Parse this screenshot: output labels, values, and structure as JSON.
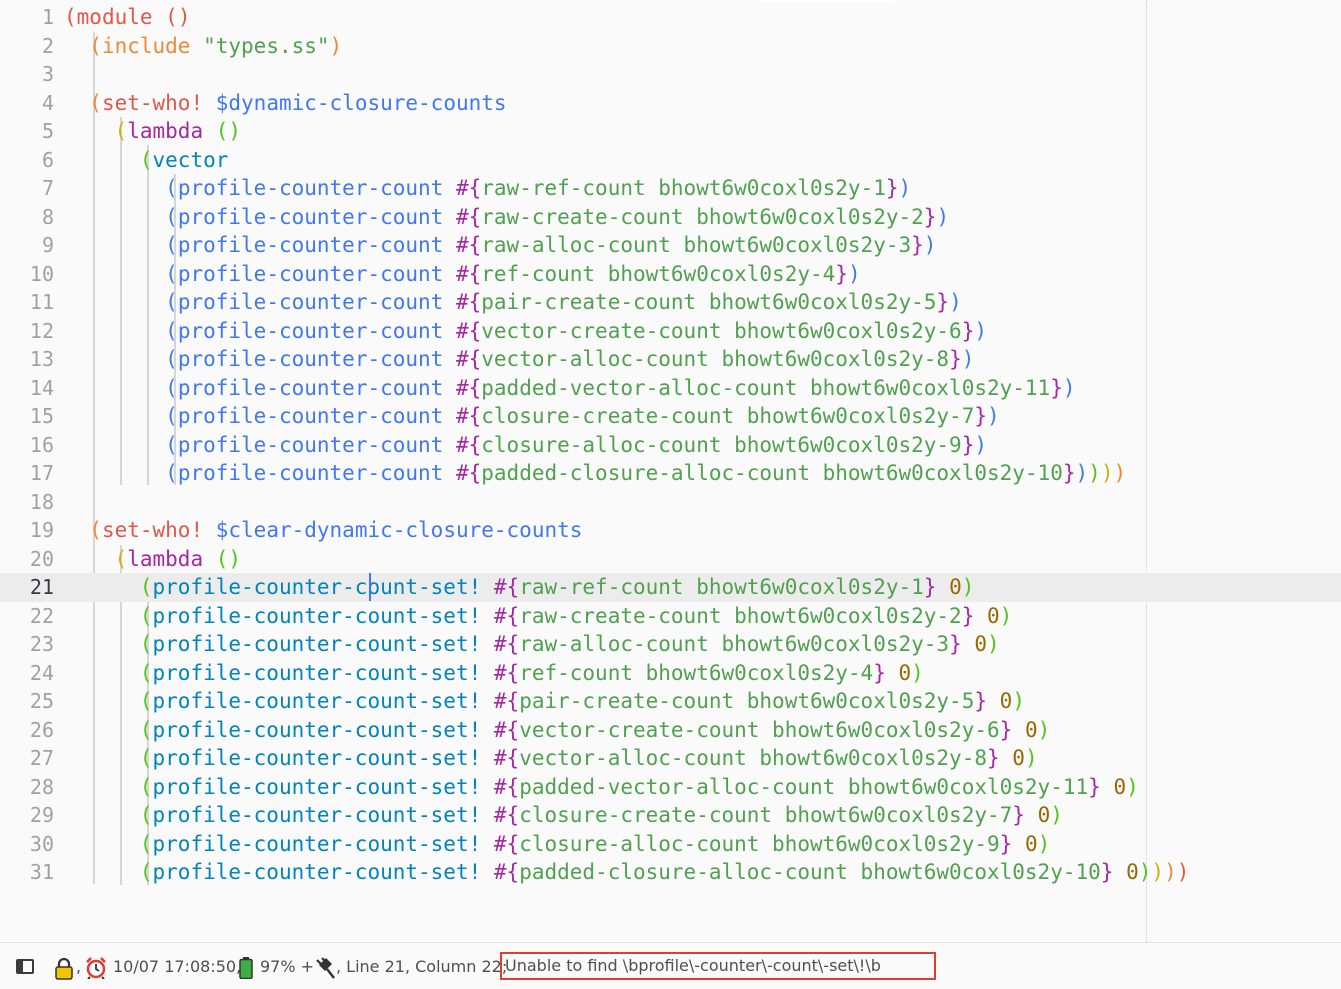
{
  "editor": {
    "current_line": 21,
    "lines": [
      [
        [
          "(",
          "#e45649"
        ],
        [
          "module ",
          "#e45649"
        ],
        [
          "()",
          "#e45649"
        ]
      ],
      [
        [
          "  "
        ],
        [
          "(",
          "#ed8936"
        ],
        [
          "include ",
          "#ed8936"
        ],
        [
          "\"types.ss\"",
          "#50a14f"
        ],
        [
          ")",
          "#ed8936"
        ]
      ],
      [],
      [
        [
          "  "
        ],
        [
          "(",
          "#ed8936"
        ],
        [
          "set-who! ",
          "#e45649"
        ],
        [
          "$dynamic-closure-counts",
          "#4078f2"
        ]
      ],
      [
        [
          "    "
        ],
        [
          "(",
          "#d4b106"
        ],
        [
          "lambda ",
          "#a626a4"
        ],
        [
          "()",
          "#52c41a"
        ]
      ],
      [
        [
          "      "
        ],
        [
          "(",
          "#52c41a"
        ],
        [
          "vector",
          "#0184bc"
        ]
      ],
      [
        [
          "        "
        ],
        [
          "(",
          "#4078f2"
        ],
        [
          "profile-counter-count ",
          "#4078f2"
        ],
        [
          "#{",
          "#a626a4"
        ],
        [
          "raw-ref-count bhowt6w0coxl0s2y-1",
          "#50a14f"
        ],
        [
          "}",
          "#a626a4"
        ],
        [
          ")",
          "#4078f2"
        ]
      ],
      [
        [
          "        "
        ],
        [
          "(",
          "#4078f2"
        ],
        [
          "profile-counter-count ",
          "#4078f2"
        ],
        [
          "#{",
          "#a626a4"
        ],
        [
          "raw-create-count bhowt6w0coxl0s2y-2",
          "#50a14f"
        ],
        [
          "}",
          "#a626a4"
        ],
        [
          ")",
          "#4078f2"
        ]
      ],
      [
        [
          "        "
        ],
        [
          "(",
          "#4078f2"
        ],
        [
          "profile-counter-count ",
          "#4078f2"
        ],
        [
          "#{",
          "#a626a4"
        ],
        [
          "raw-alloc-count bhowt6w0coxl0s2y-3",
          "#50a14f"
        ],
        [
          "}",
          "#a626a4"
        ],
        [
          ")",
          "#4078f2"
        ]
      ],
      [
        [
          "        "
        ],
        [
          "(",
          "#4078f2"
        ],
        [
          "profile-counter-count ",
          "#4078f2"
        ],
        [
          "#{",
          "#a626a4"
        ],
        [
          "ref-count bhowt6w0coxl0s2y-4",
          "#50a14f"
        ],
        [
          "}",
          "#a626a4"
        ],
        [
          ")",
          "#4078f2"
        ]
      ],
      [
        [
          "        "
        ],
        [
          "(",
          "#4078f2"
        ],
        [
          "profile-counter-count ",
          "#4078f2"
        ],
        [
          "#{",
          "#a626a4"
        ],
        [
          "pair-create-count bhowt6w0coxl0s2y-5",
          "#50a14f"
        ],
        [
          "}",
          "#a626a4"
        ],
        [
          ")",
          "#4078f2"
        ]
      ],
      [
        [
          "        "
        ],
        [
          "(",
          "#4078f2"
        ],
        [
          "profile-counter-count ",
          "#4078f2"
        ],
        [
          "#{",
          "#a626a4"
        ],
        [
          "vector-create-count bhowt6w0coxl0s2y-6",
          "#50a14f"
        ],
        [
          "}",
          "#a626a4"
        ],
        [
          ")",
          "#4078f2"
        ]
      ],
      [
        [
          "        "
        ],
        [
          "(",
          "#4078f2"
        ],
        [
          "profile-counter-count ",
          "#4078f2"
        ],
        [
          "#{",
          "#a626a4"
        ],
        [
          "vector-alloc-count bhowt6w0coxl0s2y-8",
          "#50a14f"
        ],
        [
          "}",
          "#a626a4"
        ],
        [
          ")",
          "#4078f2"
        ]
      ],
      [
        [
          "        "
        ],
        [
          "(",
          "#4078f2"
        ],
        [
          "profile-counter-count ",
          "#4078f2"
        ],
        [
          "#{",
          "#a626a4"
        ],
        [
          "padded-vector-alloc-count bhowt6w0coxl0s2y-11",
          "#50a14f"
        ],
        [
          "}",
          "#a626a4"
        ],
        [
          ")",
          "#4078f2"
        ]
      ],
      [
        [
          "        "
        ],
        [
          "(",
          "#4078f2"
        ],
        [
          "profile-counter-count ",
          "#4078f2"
        ],
        [
          "#{",
          "#a626a4"
        ],
        [
          "closure-create-count bhowt6w0coxl0s2y-7",
          "#50a14f"
        ],
        [
          "}",
          "#a626a4"
        ],
        [
          ")",
          "#4078f2"
        ]
      ],
      [
        [
          "        "
        ],
        [
          "(",
          "#4078f2"
        ],
        [
          "profile-counter-count ",
          "#4078f2"
        ],
        [
          "#{",
          "#a626a4"
        ],
        [
          "closure-alloc-count bhowt6w0coxl0s2y-9",
          "#50a14f"
        ],
        [
          "}",
          "#a626a4"
        ],
        [
          ")",
          "#4078f2"
        ]
      ],
      [
        [
          "        "
        ],
        [
          "(",
          "#4078f2"
        ],
        [
          "profile-counter-count ",
          "#4078f2"
        ],
        [
          "#{",
          "#a626a4"
        ],
        [
          "padded-closure-alloc-count bhowt6w0coxl0s2y-10",
          "#50a14f"
        ],
        [
          "}",
          "#a626a4"
        ],
        [
          ")",
          "#4078f2"
        ],
        [
          ")",
          "#52c41a"
        ],
        [
          ")",
          "#d4b106"
        ],
        [
          ")",
          "#ed8936"
        ]
      ],
      [],
      [
        [
          "  "
        ],
        [
          "(",
          "#ed8936"
        ],
        [
          "set-who! ",
          "#e45649"
        ],
        [
          "$clear-dynamic-closure-counts",
          "#4078f2"
        ]
      ],
      [
        [
          "    "
        ],
        [
          "(",
          "#d4b106"
        ],
        [
          "lambda ",
          "#a626a4"
        ],
        [
          "()",
          "#52c41a"
        ]
      ],
      [
        [
          "      "
        ],
        [
          "(",
          "#52c41a"
        ],
        [
          "profile-counter-count-set! ",
          "#0184bc"
        ],
        [
          "#{",
          "#a626a4"
        ],
        [
          "raw-ref-count bhowt6w0coxl0s2y-1",
          "#50a14f"
        ],
        [
          "}",
          "#a626a4"
        ],
        [
          " "
        ],
        [
          "0",
          "#986801"
        ],
        [
          ")",
          "#52c41a"
        ]
      ],
      [
        [
          "      "
        ],
        [
          "(",
          "#52c41a"
        ],
        [
          "profile-counter-count-set! ",
          "#0184bc"
        ],
        [
          "#{",
          "#a626a4"
        ],
        [
          "raw-create-count bhowt6w0coxl0s2y-2",
          "#50a14f"
        ],
        [
          "}",
          "#a626a4"
        ],
        [
          " "
        ],
        [
          "0",
          "#986801"
        ],
        [
          ")",
          "#52c41a"
        ]
      ],
      [
        [
          "      "
        ],
        [
          "(",
          "#52c41a"
        ],
        [
          "profile-counter-count-set! ",
          "#0184bc"
        ],
        [
          "#{",
          "#a626a4"
        ],
        [
          "raw-alloc-count bhowt6w0coxl0s2y-3",
          "#50a14f"
        ],
        [
          "}",
          "#a626a4"
        ],
        [
          " "
        ],
        [
          "0",
          "#986801"
        ],
        [
          ")",
          "#52c41a"
        ]
      ],
      [
        [
          "      "
        ],
        [
          "(",
          "#52c41a"
        ],
        [
          "profile-counter-count-set! ",
          "#0184bc"
        ],
        [
          "#{",
          "#a626a4"
        ],
        [
          "ref-count bhowt6w0coxl0s2y-4",
          "#50a14f"
        ],
        [
          "}",
          "#a626a4"
        ],
        [
          " "
        ],
        [
          "0",
          "#986801"
        ],
        [
          ")",
          "#52c41a"
        ]
      ],
      [
        [
          "      "
        ],
        [
          "(",
          "#52c41a"
        ],
        [
          "profile-counter-count-set! ",
          "#0184bc"
        ],
        [
          "#{",
          "#a626a4"
        ],
        [
          "pair-create-count bhowt6w0coxl0s2y-5",
          "#50a14f"
        ],
        [
          "}",
          "#a626a4"
        ],
        [
          " "
        ],
        [
          "0",
          "#986801"
        ],
        [
          ")",
          "#52c41a"
        ]
      ],
      [
        [
          "      "
        ],
        [
          "(",
          "#52c41a"
        ],
        [
          "profile-counter-count-set! ",
          "#0184bc"
        ],
        [
          "#{",
          "#a626a4"
        ],
        [
          "vector-create-count bhowt6w0coxl0s2y-6",
          "#50a14f"
        ],
        [
          "}",
          "#a626a4"
        ],
        [
          " "
        ],
        [
          "0",
          "#986801"
        ],
        [
          ")",
          "#52c41a"
        ]
      ],
      [
        [
          "      "
        ],
        [
          "(",
          "#52c41a"
        ],
        [
          "profile-counter-count-set! ",
          "#0184bc"
        ],
        [
          "#{",
          "#a626a4"
        ],
        [
          "vector-alloc-count bhowt6w0coxl0s2y-8",
          "#50a14f"
        ],
        [
          "}",
          "#a626a4"
        ],
        [
          " "
        ],
        [
          "0",
          "#986801"
        ],
        [
          ")",
          "#52c41a"
        ]
      ],
      [
        [
          "      "
        ],
        [
          "(",
          "#52c41a"
        ],
        [
          "profile-counter-count-set! ",
          "#0184bc"
        ],
        [
          "#{",
          "#a626a4"
        ],
        [
          "padded-vector-alloc-count bhowt6w0coxl0s2y-11",
          "#50a14f"
        ],
        [
          "}",
          "#a626a4"
        ],
        [
          " "
        ],
        [
          "0",
          "#986801"
        ],
        [
          ")",
          "#52c41a"
        ]
      ],
      [
        [
          "      "
        ],
        [
          "(",
          "#52c41a"
        ],
        [
          "profile-counter-count-set! ",
          "#0184bc"
        ],
        [
          "#{",
          "#a626a4"
        ],
        [
          "closure-create-count bhowt6w0coxl0s2y-7",
          "#50a14f"
        ],
        [
          "}",
          "#a626a4"
        ],
        [
          " "
        ],
        [
          "0",
          "#986801"
        ],
        [
          ")",
          "#52c41a"
        ]
      ],
      [
        [
          "      "
        ],
        [
          "(",
          "#52c41a"
        ],
        [
          "profile-counter-count-set! ",
          "#0184bc"
        ],
        [
          "#{",
          "#a626a4"
        ],
        [
          "closure-alloc-count bhowt6w0coxl0s2y-9",
          "#50a14f"
        ],
        [
          "}",
          "#a626a4"
        ],
        [
          " "
        ],
        [
          "0",
          "#986801"
        ],
        [
          ")",
          "#52c41a"
        ]
      ],
      [
        [
          "      "
        ],
        [
          "(",
          "#52c41a"
        ],
        [
          "profile-counter-count-set! ",
          "#0184bc"
        ],
        [
          "#{",
          "#a626a4"
        ],
        [
          "padded-closure-alloc-count bhowt6w0coxl0s2y-10",
          "#50a14f"
        ],
        [
          "}",
          "#a626a4"
        ],
        [
          " "
        ],
        [
          "0",
          "#986801"
        ],
        [
          ")",
          "#52c41a"
        ],
        [
          ")",
          "#d4b106"
        ],
        [
          ")",
          "#ed8936"
        ],
        [
          ")",
          "#e45649"
        ]
      ]
    ]
  },
  "status": {
    "sep1": ",",
    "datetime": "10/07 17:08:50,",
    "battery": "97% +",
    "position": ", Line 21, Column 22;",
    "message": "Unable to find \\bprofile\\-counter\\-count\\-set\\!\\b"
  },
  "colors": {
    "background": "#fafafa",
    "line_number": "#a0a1a7",
    "current_line_bg": "#ececec",
    "cursor": "#4078f2",
    "highlight_box": "#e53935"
  },
  "icons": [
    "sidebar-toggle-icon",
    "lock-icon",
    "alarm-clock-icon",
    "battery-icon",
    "plug-icon"
  ]
}
